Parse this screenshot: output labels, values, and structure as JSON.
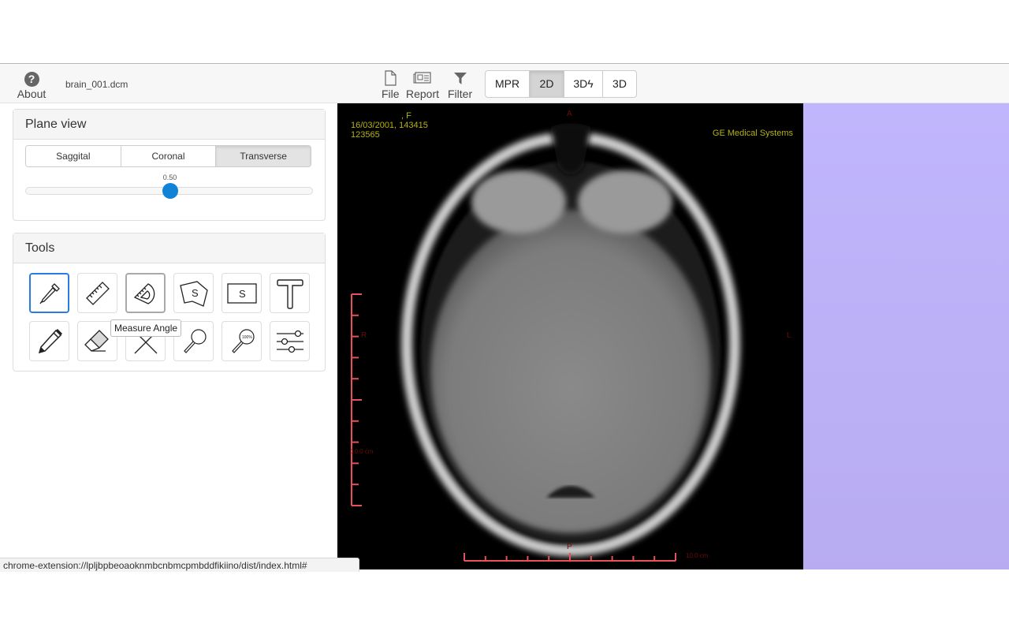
{
  "topbar": {
    "about": {
      "icon": "question-circle-icon",
      "label": "About"
    },
    "filename": "brain_001.dcm",
    "actions": [
      {
        "icon": "file-icon",
        "label": "File"
      },
      {
        "icon": "report-icon",
        "label": "Report"
      },
      {
        "icon": "filter-icon",
        "label": "Filter"
      }
    ],
    "view_modes": [
      {
        "label": "MPR",
        "active": false
      },
      {
        "label": "2D",
        "active": true
      },
      {
        "label": "3Dϟ",
        "active": false
      },
      {
        "label": "3D",
        "active": false
      }
    ]
  },
  "plane_view": {
    "title": "Plane view",
    "planes": [
      {
        "label": "Saggital",
        "active": false
      },
      {
        "label": "Coronal",
        "active": false
      },
      {
        "label": "Transverse",
        "active": true
      }
    ],
    "slider": {
      "value_label": "0.50",
      "value": 0.5,
      "min": 0,
      "max": 1
    }
  },
  "tools": {
    "title": "Tools",
    "items": [
      {
        "name": "dropper-tool",
        "icon": "eyedropper-icon",
        "state": "selected"
      },
      {
        "name": "ruler-tool",
        "icon": "ruler-icon",
        "state": "normal"
      },
      {
        "name": "measure-angle-tool",
        "icon": "protractor-icon",
        "state": "hover"
      },
      {
        "name": "polygon-roi-tool",
        "icon": "polygon-s-icon",
        "state": "normal",
        "glyph": "S"
      },
      {
        "name": "rectangle-roi-tool",
        "icon": "rectangle-s-icon",
        "state": "normal",
        "glyph": "S"
      },
      {
        "name": "text-tool",
        "icon": "text-t-icon",
        "state": "normal"
      },
      {
        "name": "pencil-tool",
        "icon": "pencil-icon",
        "state": "normal"
      },
      {
        "name": "eraser-tool",
        "icon": "eraser-icon",
        "state": "normal"
      },
      {
        "name": "crosshair-tool",
        "icon": "cross-lines-icon",
        "state": "normal"
      },
      {
        "name": "magnify-tool",
        "icon": "magnifier-icon",
        "state": "normal"
      },
      {
        "name": "zoom-100-tool",
        "icon": "magnifier-100-icon",
        "state": "normal",
        "glyph": "100%"
      },
      {
        "name": "adjust-tool",
        "icon": "sliders-icon",
        "state": "normal"
      }
    ],
    "tooltip": "Measure Angle"
  },
  "viewer": {
    "overlay_top_left": [
      ", F",
      "16/03/2001, 143415",
      "123565"
    ],
    "overlay_top_right": "GE Medical Systems",
    "orientation": {
      "top": "A",
      "bottom": "P",
      "left": "R",
      "right": "L"
    },
    "vertical_scale_label": "10.0 cm",
    "horizontal_scale_label": "10.0 cm",
    "colors": {
      "overlay_text": "#b5b313",
      "scale": "#e8505b",
      "orientation_text": "#6e0a0a"
    }
  },
  "side_panel": {
    "color": "#c0b6fd"
  },
  "status_bar": {
    "url": "chrome-extension://lpljbpbeoaoknmbcnbmcpmbddfikiino/dist/index.html#"
  }
}
